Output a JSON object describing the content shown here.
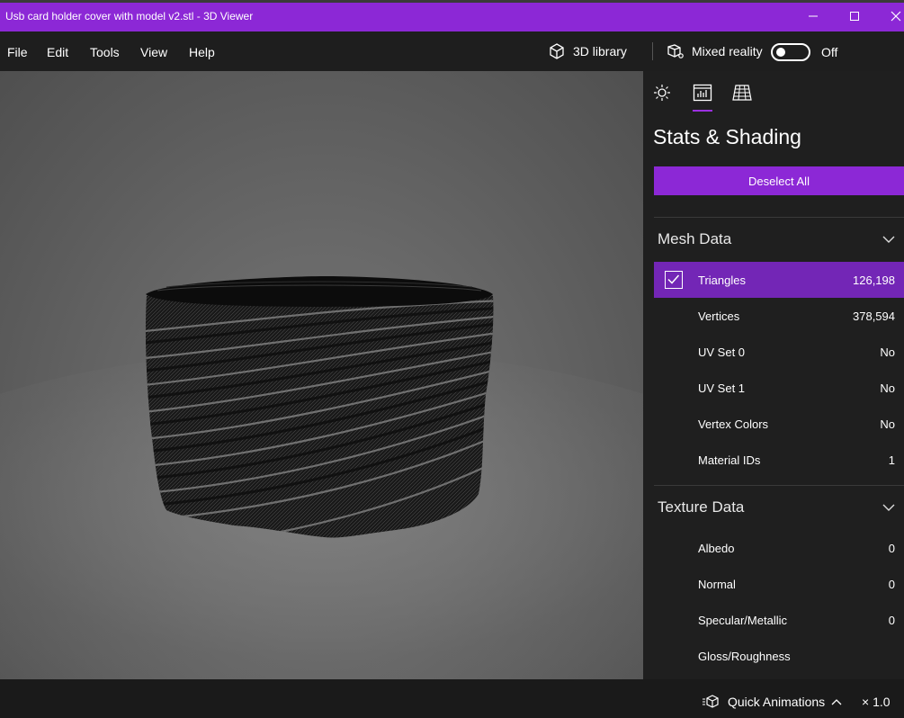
{
  "window": {
    "title": "Usb card holder cover with model v2.stl - 3D Viewer",
    "accent_color": "#8c28d6"
  },
  "menu": {
    "items": [
      "File",
      "Edit",
      "Tools",
      "View",
      "Help"
    ],
    "library_label": "3D library",
    "mixed_reality_label": "Mixed reality",
    "mixed_reality_state": "Off"
  },
  "panel": {
    "tabs": [
      "sun-icon",
      "stats-icon",
      "grid-icon"
    ],
    "title": "Stats & Shading",
    "deselect_label": "Deselect All",
    "mesh_section": {
      "title": "Mesh Data",
      "rows": [
        {
          "label": "Triangles",
          "value": "126,198",
          "checked": true
        },
        {
          "label": "Vertices",
          "value": "378,594"
        },
        {
          "label": "UV Set 0",
          "value": "No"
        },
        {
          "label": "UV Set 1",
          "value": "No"
        },
        {
          "label": "Vertex Colors",
          "value": "No"
        },
        {
          "label": "Material IDs",
          "value": "1"
        }
      ]
    },
    "texture_section": {
      "title": "Texture Data",
      "rows": [
        {
          "label": "Albedo",
          "value": "0"
        },
        {
          "label": "Normal",
          "value": "0"
        },
        {
          "label": "Specular/Metallic",
          "value": "0"
        },
        {
          "label": "Gloss/Roughness",
          "value": ""
        }
      ]
    }
  },
  "status": {
    "animations_label": "Quick Animations",
    "speed": "× 1.0"
  }
}
